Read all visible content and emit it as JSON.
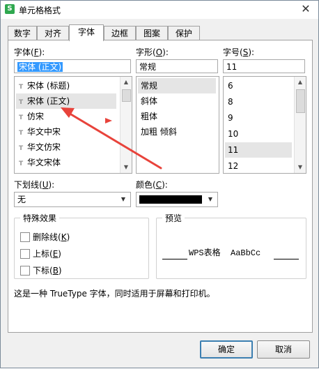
{
  "window": {
    "title": "单元格格式",
    "app_icon": "S",
    "close_glyph": "✕"
  },
  "tabs": [
    {
      "label": "数字"
    },
    {
      "label": "对齐"
    },
    {
      "label": "字体"
    },
    {
      "label": "边框"
    },
    {
      "label": "图案"
    },
    {
      "label": "保护"
    }
  ],
  "font": {
    "label": "字体(",
    "key": "F",
    "label_end": "):",
    "value": "宋体 (正文)",
    "items": [
      {
        "tt": "T̶",
        "label": "宋体 (标题)"
      },
      {
        "tt": "T̶",
        "label": "宋体 (正文)"
      },
      {
        "tt": "T̶",
        "label": "仿宋"
      },
      {
        "tt": "T̶",
        "label": "华文中宋"
      },
      {
        "tt": "T̶",
        "label": "华文仿宋"
      },
      {
        "tt": "T̶",
        "label": "华文宋体"
      }
    ]
  },
  "style": {
    "label": "字形(",
    "key": "O",
    "label_end": "):",
    "value": "常规",
    "items": [
      {
        "label": "常规"
      },
      {
        "label": "斜体"
      },
      {
        "label": "粗体"
      },
      {
        "label": "加粗 倾斜"
      }
    ]
  },
  "size": {
    "label": "字号(",
    "key": "S",
    "label_end": "):",
    "value": "11",
    "items": [
      {
        "label": "6"
      },
      {
        "label": "8"
      },
      {
        "label": "9"
      },
      {
        "label": "10"
      },
      {
        "label": "11"
      },
      {
        "label": "12"
      }
    ]
  },
  "underline": {
    "label": "下划线(",
    "key": "U",
    "label_end": "):",
    "value": "无"
  },
  "color": {
    "label": "颜色(",
    "key": "C",
    "label_end": "):",
    "swatch": "#000000"
  },
  "effects": {
    "title": "特殊效果",
    "items": [
      {
        "label": "删除线(",
        "key": "K",
        "label_end": ")"
      },
      {
        "label": "上标(",
        "key": "E",
        "label_end": ")"
      },
      {
        "label": "下标(",
        "key": "B",
        "label_end": ")"
      }
    ]
  },
  "preview": {
    "title": "预览",
    "text": "WPS表格  AaBbCc"
  },
  "description": "这是一种 TrueType 字体，同时适用于屏幕和打印机。",
  "buttons": {
    "ok": "确定",
    "cancel": "取消"
  },
  "annotation_color": "#e8433b",
  "selection_color": "#3399ff"
}
